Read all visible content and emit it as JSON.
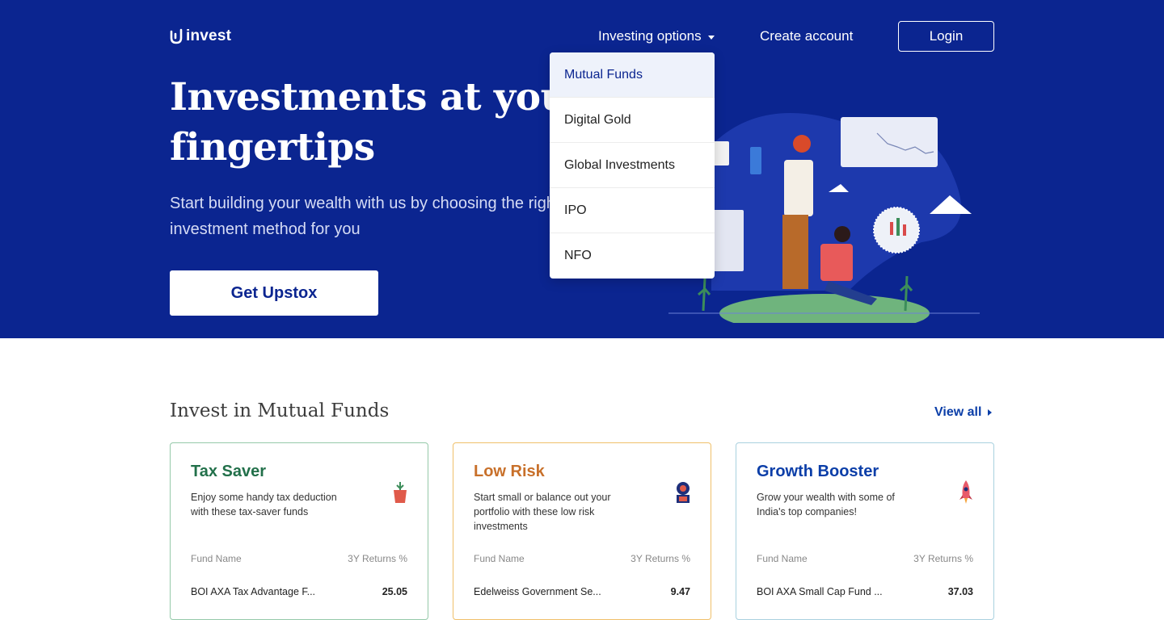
{
  "header": {
    "logo_text": "invest",
    "nav": {
      "investing_label": "Investing options",
      "create_label": "Create account",
      "login_label": "Login"
    }
  },
  "dropdown": {
    "items": [
      "Mutual Funds",
      "Digital Gold",
      "Global Investments",
      "IPO",
      "NFO"
    ],
    "active": "Mutual Funds"
  },
  "hero": {
    "title": "Investments at your fingertips",
    "subtitle": "Start building your wealth with us by choosing the right investment method for you",
    "cta_label": "Get Upstox"
  },
  "mutual_funds": {
    "title": "Invest in Mutual Funds",
    "view_all": "View all",
    "cards": [
      {
        "title": "Tax Saver",
        "description": "Enjoy some handy tax deduction with these tax-saver funds",
        "col_name": "Fund Name",
        "col_returns": "3Y Returns %",
        "fund": "BOI AXA Tax Advantage F...",
        "returns": "25.05",
        "icon": "plant-pot-icon"
      },
      {
        "title": "Low Risk",
        "description": "Start small or balance out your portfolio with these low risk investments",
        "col_name": "Fund Name",
        "col_returns": "3Y Returns %",
        "fund": "Edelweiss Government Se...",
        "returns": "9.47",
        "icon": "shield-lock-icon"
      },
      {
        "title": "Growth Booster",
        "description": "Grow your wealth with some of India's top companies!",
        "col_name": "Fund Name",
        "col_returns": "3Y Returns %",
        "fund": "BOI AXA Small Cap Fund ...",
        "returns": "37.03",
        "icon": "rocket-icon"
      }
    ]
  },
  "colors": {
    "hero_bg": "#0b2590",
    "accent_blue": "#0b3ea8",
    "green": "#22704a",
    "orange": "#c8702a"
  }
}
